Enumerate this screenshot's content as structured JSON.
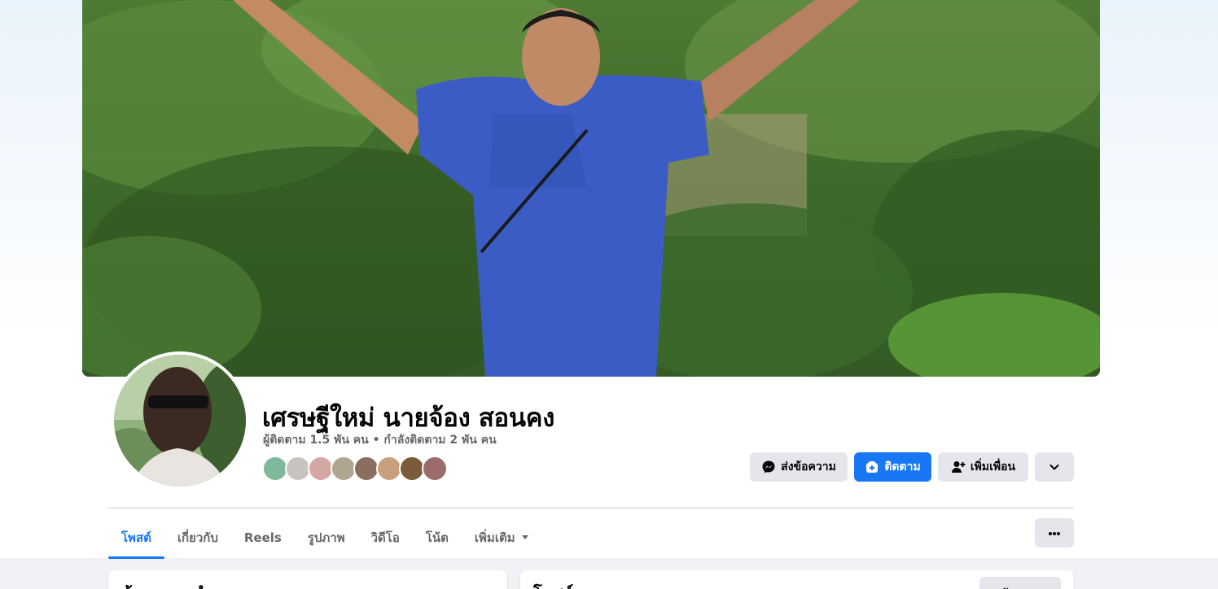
{
  "profile": {
    "name": "เศรษฐีใหม่ นายจ้อง สอนคง",
    "stats": "ผู้ติดตาม 1.5 พัน คน • กำลังติดตาม 2 พัน คน"
  },
  "actions": {
    "message_label": "ส่งข้อความ",
    "follow_label": "ติดตาม",
    "add_friend_label": "เพิ่มเพื่อน"
  },
  "tabs": [
    {
      "label": "โพสต์"
    },
    {
      "label": "เกี่ยวกับ"
    },
    {
      "label": "Reels"
    },
    {
      "label": "รูปภาพ"
    },
    {
      "label": "วิดีโอ"
    },
    {
      "label": "โน้ต"
    },
    {
      "label": "เพิ่มเติม"
    }
  ],
  "cards": {
    "left_title": "ข้อมูลแนะนำ",
    "right_title": "โพสต์",
    "filter_label": "ตัวกรอง"
  },
  "colors": {
    "accent": "#1877f2",
    "secondary_button": "#e4e6eb",
    "muted_text": "#65676b"
  },
  "icons": [
    "messenger-icon",
    "follow-plus-icon",
    "add-friend-icon",
    "chevron-down-icon",
    "more-dots-icon",
    "caret-down-icon"
  ]
}
